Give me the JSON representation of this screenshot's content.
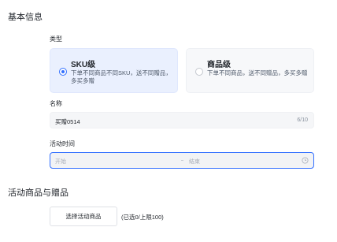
{
  "basic_info": {
    "title": "基本信息",
    "type_label": "类型",
    "type_options": [
      {
        "title": "SKU级",
        "description": "下单不同商品不同SKU，送不同赠品，多买多赠",
        "selected": true
      },
      {
        "title": "商品级",
        "description": "下单不同商品，送不同赠品，多买多赠",
        "selected": false
      }
    ],
    "name_label": "名称",
    "name_value": "买赠0514",
    "name_count": "6/10",
    "time_label": "活动时间",
    "time_start_placeholder": "开始",
    "time_end_placeholder": "结束"
  },
  "goods_section": {
    "title": "活动商品与赠品",
    "select_button_label": "选择活动商品",
    "selected_hint": "(已选0/上限100)"
  },
  "colors": {
    "accent": "#3370ff",
    "selected_card_bg": "#eaf0fe",
    "card_bg": "#f7f8fa"
  }
}
